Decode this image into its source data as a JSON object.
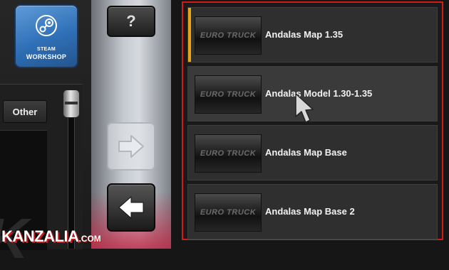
{
  "steam_workshop": {
    "line1": "STEAM",
    "line2": "WORKSHOP",
    "icon": "steam-icon",
    "color": "#3a7cc4"
  },
  "category_tab": {
    "label": "Other"
  },
  "mod_list_letter": "K",
  "help_button": {
    "label": "?"
  },
  "nav_buttons": {
    "next_icon": "arrow-right-icon",
    "next_enabled": false,
    "prev_icon": "arrow-left-icon",
    "prev_enabled": true
  },
  "active_mods": {
    "border_color": "#d11c1c",
    "selection_color": "#e8a317",
    "items": [
      {
        "name": "Andalas Map 1.35",
        "thumbnail_text": "EURO TRUCK",
        "selected": true,
        "hovered": false
      },
      {
        "name": "Andalas Model 1.30-1.35",
        "thumbnail_text": "EURO TRUCK",
        "selected": false,
        "hovered": true
      },
      {
        "name": "Andalas Map Base",
        "thumbnail_text": "EURO TRUCK",
        "selected": false,
        "hovered": false
      },
      {
        "name": "Andalas Map Base 2",
        "thumbnail_text": "EURO TRUCK",
        "selected": false,
        "hovered": false
      }
    ]
  },
  "watermark": {
    "main": "KANZALIA",
    "suffix": ".COM"
  }
}
